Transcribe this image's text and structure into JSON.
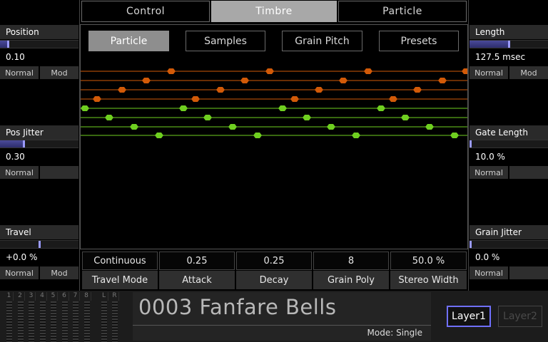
{
  "top_tabs": [
    "Control",
    "Timbre",
    "Particle"
  ],
  "sub_tabs": [
    "Particle",
    "Samples",
    "Grain Pitch",
    "Presets"
  ],
  "left_panel": {
    "position": {
      "title": "Position",
      "value": "0.10",
      "level": 0.1,
      "btn1": "Normal",
      "btn2": "Mod"
    },
    "pos_jitter": {
      "title": "Pos Jitter",
      "value": "0.30",
      "level": 0.3,
      "btn1": "Normal"
    },
    "travel": {
      "title": "Travel",
      "value": "+0.0 %",
      "level": 0.5,
      "btn1": "Normal",
      "btn2": "Mod"
    }
  },
  "right_panel": {
    "length": {
      "title": "Length",
      "value": "127.5 msec",
      "level": 0.5,
      "btn1": "Normal",
      "btn2": "Mod"
    },
    "gate_length": {
      "title": "Gate Length",
      "value": "10.0 %",
      "level": 0.0,
      "btn1": "Normal"
    },
    "grain_jitter": {
      "title": "Grain Jitter",
      "value": "0.0 %",
      "level": 0.0,
      "btn1": "Normal"
    }
  },
  "params": [
    {
      "value": "Continuous",
      "label": "Travel Mode"
    },
    {
      "value": "0.25",
      "label": "Attack"
    },
    {
      "value": "0.25",
      "label": "Decay"
    },
    {
      "value": "8",
      "label": "Grain Poly"
    },
    {
      "value": "50.0 %",
      "label": "Stereo Width"
    }
  ],
  "meters": {
    "channels": [
      "1",
      "2",
      "3",
      "4",
      "5",
      "6",
      "7",
      "8"
    ],
    "master": [
      "L",
      "R"
    ]
  },
  "preset": {
    "name": "0003 Fanfare Bells",
    "mode": "Mode: Single"
  },
  "layers": {
    "layer1": "Layer1",
    "layer2": "Layer2"
  },
  "colors": {
    "orange": "#d25a08",
    "green": "#6fcf20",
    "accent": "#7070ff"
  }
}
